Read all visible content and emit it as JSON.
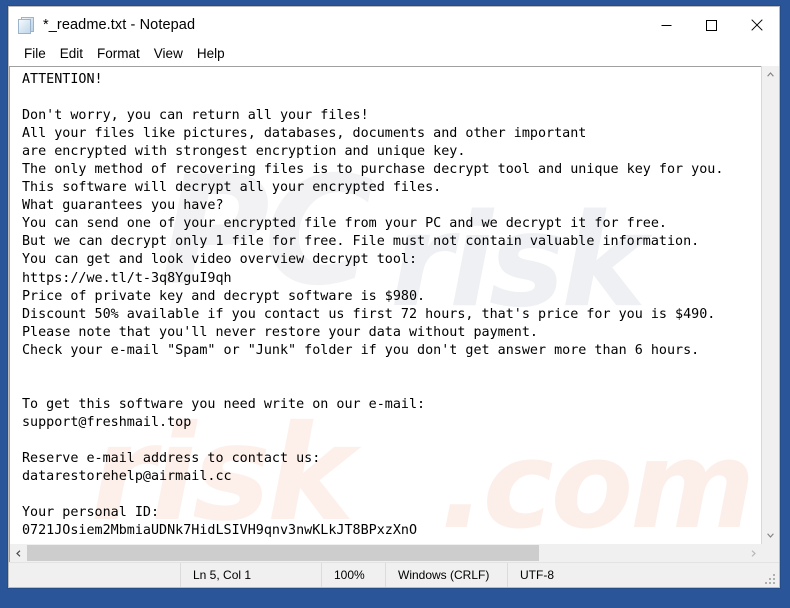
{
  "window": {
    "title": "*_readme.txt - Notepad",
    "icon": "notepad-document-icon",
    "controls": {
      "minimize": "Minimize",
      "maximize": "Maximize",
      "close": "Close"
    }
  },
  "menubar": {
    "items": [
      {
        "label": "File"
      },
      {
        "label": "Edit"
      },
      {
        "label": "Format"
      },
      {
        "label": "View"
      },
      {
        "label": "Help"
      }
    ]
  },
  "editor": {
    "content": "ATTENTION!\n\nDon't worry, you can return all your files!\nAll your files like pictures, databases, documents and other important\nare encrypted with strongest encryption and unique key.\nThe only method of recovering files is to purchase decrypt tool and unique key for you.\nThis software will decrypt all your encrypted files.\nWhat guarantees you have?\nYou can send one of your encrypted file from your PC and we decrypt it for free.\nBut we can decrypt only 1 file for free. File must not contain valuable information.\nYou can get and look video overview decrypt tool:\nhttps://we.tl/t-3q8YguI9qh\nPrice of private key and decrypt software is $980.\nDiscount 50% available if you contact us first 72 hours, that's price for you is $490.\nPlease note that you'll never restore your data without payment.\nCheck your e-mail \"Spam\" or \"Junk\" folder if you don't get answer more than 6 hours.\n\n\nTo get this software you need write on our e-mail:\nsupport@freshmail.top\n\nReserve e-mail address to contact us:\ndatarestorehelp@airmail.cc\n\nYour personal ID:\n0721JOsiem2MbmiaUDNk7HidLSIVH9qnv3nwKLkJT8BPxzXnO",
    "watermark": {
      "line1": "PC",
      "line2": "risk",
      "line3": "risk",
      "line4": ".com"
    }
  },
  "scrollbars": {
    "vertical": {
      "up": "▲",
      "down": "▼"
    },
    "horizontal": {
      "left": "◄",
      "right": "►"
    }
  },
  "statusbar": {
    "position": "Ln 5, Col 1",
    "zoom": "100%",
    "line_ending": "Windows (CRLF)",
    "encoding": "UTF-8"
  },
  "colors": {
    "desktop": "#2a5699",
    "window": "#ffffff",
    "statusbar": "#f0f0f0",
    "scroll_thumb": "#cdcdcd",
    "text": "#000000"
  }
}
